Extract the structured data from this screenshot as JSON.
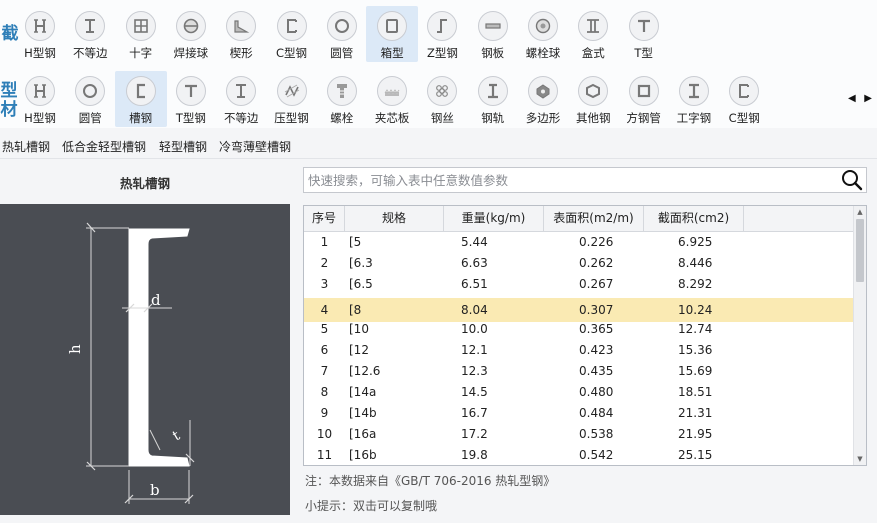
{
  "toolbar": {
    "row1_label": "截",
    "row2_label": "型材",
    "row1_items": [
      {
        "label": "H型钢",
        "icon": "h-beam-icon"
      },
      {
        "label": "不等边",
        "icon": "unequal-angle-icon"
      },
      {
        "label": "十字",
        "icon": "cross-icon"
      },
      {
        "label": "焊接球",
        "icon": "welded-ball-icon"
      },
      {
        "label": "楔形",
        "icon": "wedge-icon"
      },
      {
        "label": "C型钢",
        "icon": "c-section-icon"
      },
      {
        "label": "圆管",
        "icon": "round-tube-icon"
      },
      {
        "label": "箱型",
        "icon": "box-section-icon"
      },
      {
        "label": "Z型钢",
        "icon": "z-section-icon"
      },
      {
        "label": "钢板",
        "icon": "steel-plate-icon"
      },
      {
        "label": "螺栓球",
        "icon": "bolt-ball-icon"
      },
      {
        "label": "盒式",
        "icon": "box-type-icon"
      },
      {
        "label": "T型",
        "icon": "t-section-icon"
      }
    ],
    "row1_selected": 7,
    "row2_items": [
      {
        "label": "H型钢",
        "icon": "h-beam-icon"
      },
      {
        "label": "圆管",
        "icon": "round-tube-icon"
      },
      {
        "label": "槽钢",
        "icon": "channel-icon"
      },
      {
        "label": "T型钢",
        "icon": "t-section-icon"
      },
      {
        "label": "不等边",
        "icon": "unequal-angle-icon"
      },
      {
        "label": "压型钢",
        "icon": "profiled-steel-icon"
      },
      {
        "label": "螺栓",
        "icon": "bolt-icon"
      },
      {
        "label": "夹芯板",
        "icon": "sandwich-panel-icon"
      },
      {
        "label": "钢丝",
        "icon": "steel-wire-icon"
      },
      {
        "label": "钢轨",
        "icon": "rail-icon"
      },
      {
        "label": "多边形",
        "icon": "polygon-icon"
      },
      {
        "label": "其他钢",
        "icon": "other-steel-icon"
      },
      {
        "label": "方钢管",
        "icon": "square-tube-icon"
      },
      {
        "label": "工字钢",
        "icon": "i-beam-icon"
      },
      {
        "label": "C型钢",
        "icon": "c-section-icon"
      }
    ],
    "row2_selected": 2
  },
  "subtabs": [
    "热轧槽钢",
    "低合金轻型槽钢",
    "轻型槽钢",
    "冷弯薄壁槽钢"
  ],
  "section_title": "热轧槽钢",
  "diagram_labels": {
    "d": "d",
    "h": "h",
    "b": "b",
    "r": "r",
    "t": "t"
  },
  "search": {
    "placeholder": "快速搜索，可输入表中任意数值参数",
    "value": ""
  },
  "table": {
    "columns": [
      "序号",
      "规格",
      "重量(kg/m)",
      "表面积(m2/m)",
      "截面积(cm2)"
    ],
    "rows": [
      [
        "1",
        "[5",
        "5.44",
        "0.226",
        "6.925"
      ],
      [
        "2",
        "[6.3",
        "6.63",
        "0.262",
        "8.446"
      ],
      [
        "3",
        "[6.5",
        "6.51",
        "0.267",
        "8.292"
      ],
      [
        "4",
        "[8",
        "8.04",
        "0.307",
        "10.24"
      ],
      [
        "5",
        "[10",
        "10.0",
        "0.365",
        "12.74"
      ],
      [
        "6",
        "[12",
        "12.1",
        "0.423",
        "15.36"
      ],
      [
        "7",
        "[12.6",
        "12.3",
        "0.435",
        "15.69"
      ],
      [
        "8",
        "[14a",
        "14.5",
        "0.480",
        "18.51"
      ],
      [
        "9",
        "[14b",
        "16.7",
        "0.484",
        "21.31"
      ],
      [
        "10",
        "[16a",
        "17.2",
        "0.538",
        "21.95"
      ],
      [
        "11",
        "[16b",
        "19.8",
        "0.542",
        "25.15"
      ]
    ],
    "selected_row": 3
  },
  "note": "注：本数据来自《GB/T  706-2016  热轧型钢》",
  "tip": "小提示：双击可以复制哦",
  "colors": {
    "accent": "#2f7fb8",
    "selected_row": "#faeab3",
    "selected_tool": "#dce9f7",
    "diagram_bg": "#4a4d53"
  }
}
